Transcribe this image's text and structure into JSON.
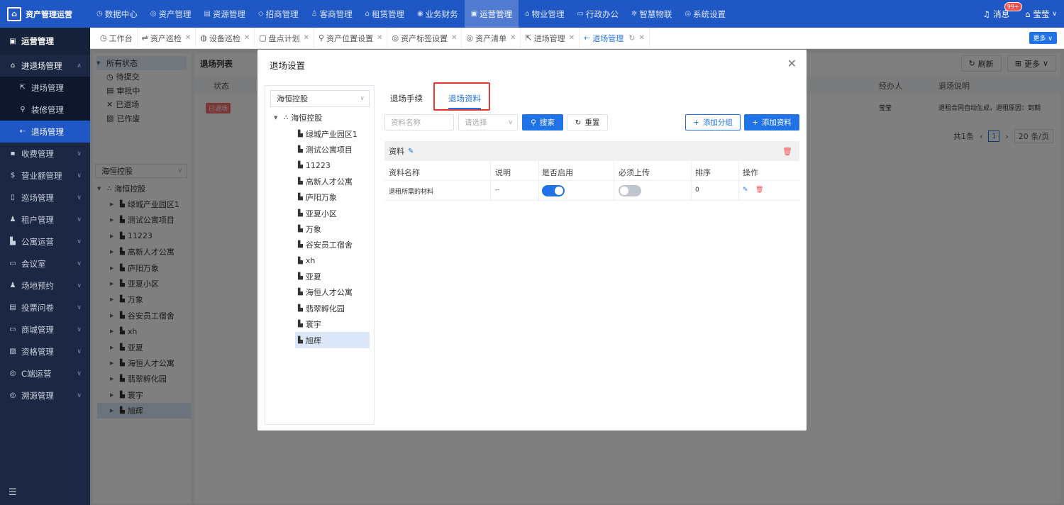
{
  "app": {
    "title": "资产管理运营"
  },
  "topnav": [
    {
      "label": "数据中心",
      "icon": "◷"
    },
    {
      "label": "资产管理",
      "icon": "◎"
    },
    {
      "label": "资源管理",
      "icon": "▤"
    },
    {
      "label": "招商管理",
      "icon": "◇"
    },
    {
      "label": "客商管理",
      "icon": "♙"
    },
    {
      "label": "租赁管理",
      "icon": "⌂"
    },
    {
      "label": "业务财务",
      "icon": "◉"
    },
    {
      "label": "运营管理",
      "icon": "▣"
    },
    {
      "label": "物业管理",
      "icon": "⌂"
    },
    {
      "label": "行政办公",
      "icon": "▭"
    },
    {
      "label": "智慧物联",
      "icon": "✲"
    },
    {
      "label": "系统设置",
      "icon": "◎"
    }
  ],
  "topright": {
    "messages": "消息",
    "badge": "99+",
    "user": "莹莹"
  },
  "sidebar": {
    "header": "运营管理",
    "items": [
      {
        "label": "进退场管理",
        "icon": "⌂"
      },
      {
        "label": "进场管理",
        "icon": "⇱"
      },
      {
        "label": "装修管理",
        "icon": "⚲"
      },
      {
        "label": "退场管理",
        "icon": "⇠"
      },
      {
        "label": "收费管理",
        "icon": "▪"
      },
      {
        "label": "营业额管理",
        "icon": "$"
      },
      {
        "label": "巡场管理",
        "icon": "▯"
      },
      {
        "label": "租户管理",
        "icon": "♟"
      },
      {
        "label": "公寓运营",
        "icon": "▙"
      },
      {
        "label": "会议室",
        "icon": "▭"
      },
      {
        "label": "场地预约",
        "icon": "♟"
      },
      {
        "label": "投票问卷",
        "icon": "▤"
      },
      {
        "label": "商城管理",
        "icon": "▭"
      },
      {
        "label": "资格管理",
        "icon": "▧"
      },
      {
        "label": "C端运营",
        "icon": "◎"
      },
      {
        "label": "溯源管理",
        "icon": "◎"
      }
    ],
    "menu_icon": "☰"
  },
  "tabs": [
    {
      "label": "工作台",
      "icon": "◷"
    },
    {
      "label": "资产巡检",
      "icon": "⇌"
    },
    {
      "label": "设备巡检",
      "icon": "◍"
    },
    {
      "label": "盘点计划",
      "icon": "▢"
    },
    {
      "label": "资产位置设置",
      "icon": "⚲"
    },
    {
      "label": "资产标签设置",
      "icon": "◎"
    },
    {
      "label": "资产清单",
      "icon": "◎"
    },
    {
      "label": "进场管理",
      "icon": "⇱"
    },
    {
      "label": "退场管理",
      "icon": "⇠"
    }
  ],
  "tabs_more": "更多 ∨",
  "bg": {
    "status_root": "所有状态",
    "statuses": [
      {
        "label": "待提交",
        "icon": "◷"
      },
      {
        "label": "审批中",
        "icon": "▤"
      },
      {
        "label": "已退场",
        "icon": "✕"
      },
      {
        "label": "已作废",
        "icon": "▧"
      }
    ],
    "org_select": "海恒控股",
    "org_root": "海恒控股",
    "projects": [
      "绿城产业园区1",
      "测试公寓项目",
      "11223",
      "高新人才公寓",
      "庐阳万象",
      "亚夏小区",
      "万象",
      "谷安员工宿舍",
      "xh",
      "亚夏",
      "海恒人才公寓",
      "翡翠孵化园",
      "寰宇",
      "旭辉"
    ],
    "list_title": "退场列表",
    "refresh": "刷新",
    "more": "更多",
    "table_headers": {
      "status": "状态",
      "handler": "经办人",
      "desc": "退场说明"
    },
    "row": {
      "status": "已退场",
      "handler": "莹莹",
      "desc": "退租合同自动生成，退租原因：到期"
    },
    "pager": {
      "total": "共1条",
      "page": "1",
      "size": "20 条/页"
    }
  },
  "modal": {
    "title": "退场设置",
    "org_select": "海恒控股",
    "tree_root": "海恒控股",
    "projects": [
      "绿城产业园区1",
      "测试公寓项目",
      "11223",
      "高新人才公寓",
      "庐阳万象",
      "亚夏小区",
      "万象",
      "谷安员工宿舍",
      "xh",
      "亚夏",
      "海恒人才公寓",
      "翡翠孵化园",
      "寰宇",
      "旭辉"
    ],
    "tabs": [
      "退场手续",
      "退场资料"
    ],
    "search": {
      "name_placeholder": "资料名称",
      "select_placeholder": "请选择",
      "search_btn": "搜索",
      "reset_btn": "重置",
      "add_group_btn": "添加分组",
      "add_item_btn": "添加资料"
    },
    "group": {
      "name": "资料"
    },
    "table": {
      "headers": [
        "资料名称",
        "说明",
        "是否启用",
        "必须上传",
        "排序",
        "操作"
      ],
      "rows": [
        {
          "name": "退租所需的材料",
          "desc": "--",
          "enabled": true,
          "required": false,
          "order": "0"
        }
      ]
    }
  }
}
